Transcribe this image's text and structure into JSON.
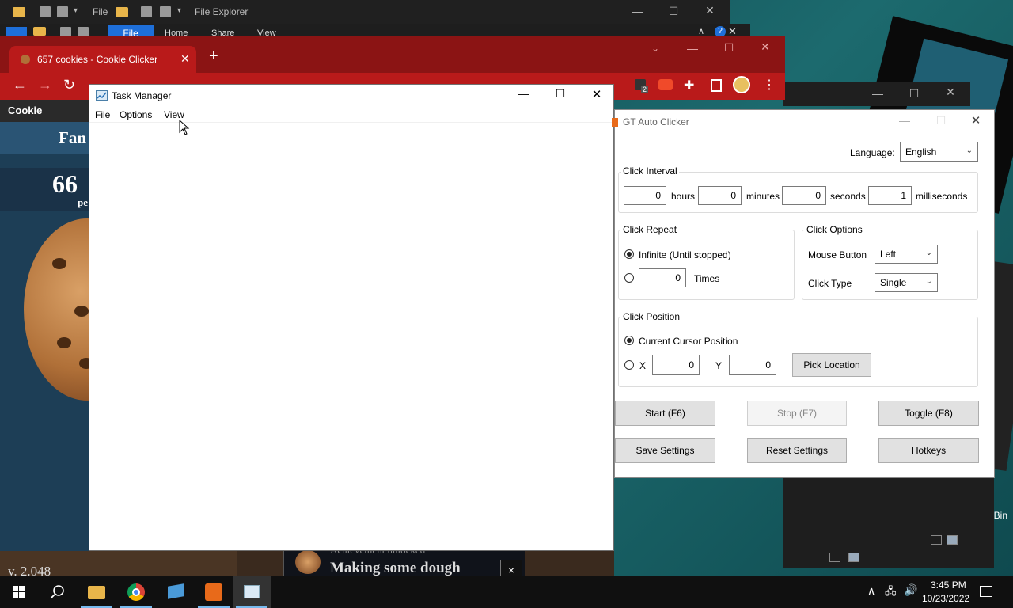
{
  "file_explorer": {
    "back_title_short": "File",
    "front_title": "File Explorer",
    "ribbon_tabs": [
      "File",
      "Home",
      "Share",
      "View"
    ]
  },
  "chrome": {
    "tab_title": "657 cookies - Cookie Clicker",
    "new_tab": "+",
    "extension_badge": "2"
  },
  "cookie_clicker": {
    "header": "Cookie Clicker™",
    "bakery_partial": "Fan",
    "count_partial": "66",
    "per_partial": "pe",
    "version_partial": "v. 2.048",
    "achievement_label": "Achievement unlocked",
    "achievement_name": "Making some dough",
    "close": "×"
  },
  "task_manager": {
    "title": "Task Manager",
    "menu": [
      "File",
      "Options",
      "View"
    ]
  },
  "gt_auto_clicker": {
    "title": "GT Auto Clicker",
    "language_label": "Language:",
    "language_value": "English",
    "click_interval": {
      "title": "Click Interval",
      "hours_value": "0",
      "hours_label": "hours",
      "minutes_value": "0",
      "minutes_label": "minutes",
      "seconds_value": "0",
      "seconds_label": "seconds",
      "ms_value": "1",
      "ms_label": "milliseconds"
    },
    "click_repeat": {
      "title": "Click Repeat",
      "infinite_label": "Infinite (Until stopped)",
      "times_value": "0",
      "times_label": "Times"
    },
    "click_options": {
      "title": "Click Options",
      "mouse_button_label": "Mouse Button",
      "mouse_button_value": "Left",
      "click_type_label": "Click Type",
      "click_type_value": "Single"
    },
    "click_position": {
      "title": "Click Position",
      "current_label": "Current Cursor Position",
      "x_label": "X",
      "x_value": "0",
      "y_label": "Y",
      "y_value": "0",
      "pick_label": "Pick Location"
    },
    "buttons": {
      "start": "Start (F6)",
      "stop": "Stop (F7)",
      "toggle": "Toggle (F8)",
      "save": "Save Settings",
      "reset": "Reset Settings",
      "hotkeys": "Hotkeys"
    }
  },
  "desktop": {
    "recycle_bin_label": "cycle Bin"
  },
  "taskbar": {
    "time": "3:45 PM",
    "date": "10/23/2022"
  }
}
